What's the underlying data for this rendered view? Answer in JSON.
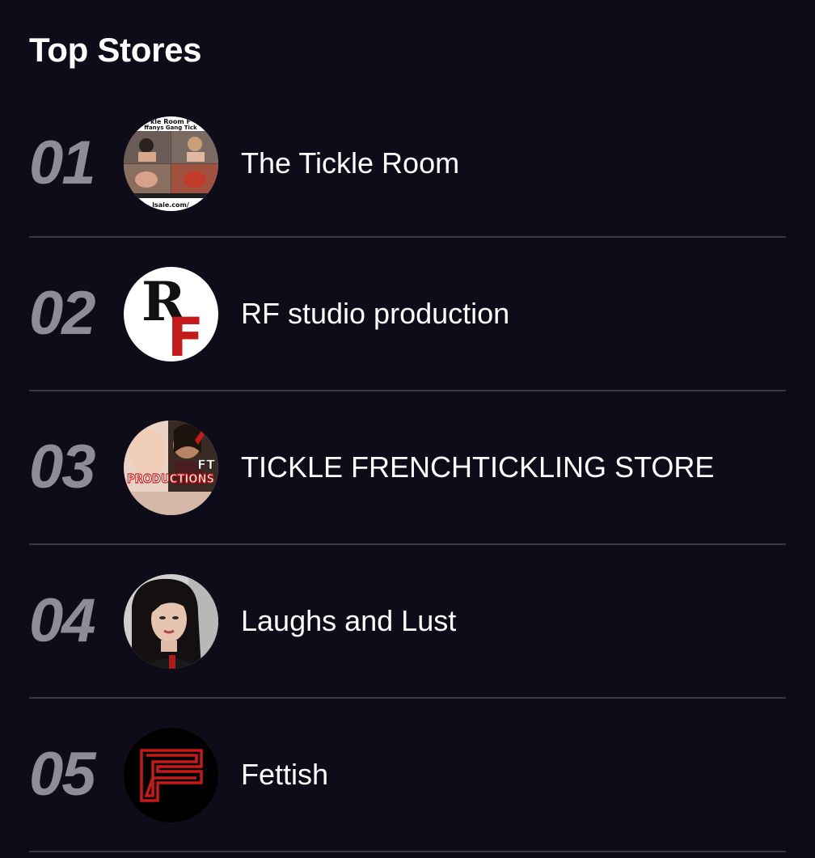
{
  "section": {
    "title": "Top Stores"
  },
  "stores": [
    {
      "rank": "01",
      "name": "The Tickle Room",
      "avatar": {
        "icon": "collage-thumbnail",
        "caption_top_1": "kle Room F",
        "caption_top_2": "ffanys Gang Tick",
        "caption_bottom": "lsale.com/"
      }
    },
    {
      "rank": "02",
      "name": "RF studio production",
      "avatar": {
        "icon": "rf-logo",
        "letter_1": "R",
        "letter_2": "F"
      }
    },
    {
      "rank": "03",
      "name": "TICKLE FRENCHTICKLING STORE",
      "avatar": {
        "icon": "ft-productions-logo",
        "badge": "FT",
        "label": "PRODUCTIONS"
      }
    },
    {
      "rank": "04",
      "name": "Laughs and Lust",
      "avatar": {
        "icon": "portrait-photo"
      }
    },
    {
      "rank": "05",
      "name": "Fettish",
      "avatar": {
        "icon": "f-monogram-logo"
      }
    }
  ],
  "colors": {
    "background": "#0f0c1a",
    "rank_text": "#8e8c95",
    "divider": "#3a3842",
    "logo_red": "#c41a1a"
  }
}
